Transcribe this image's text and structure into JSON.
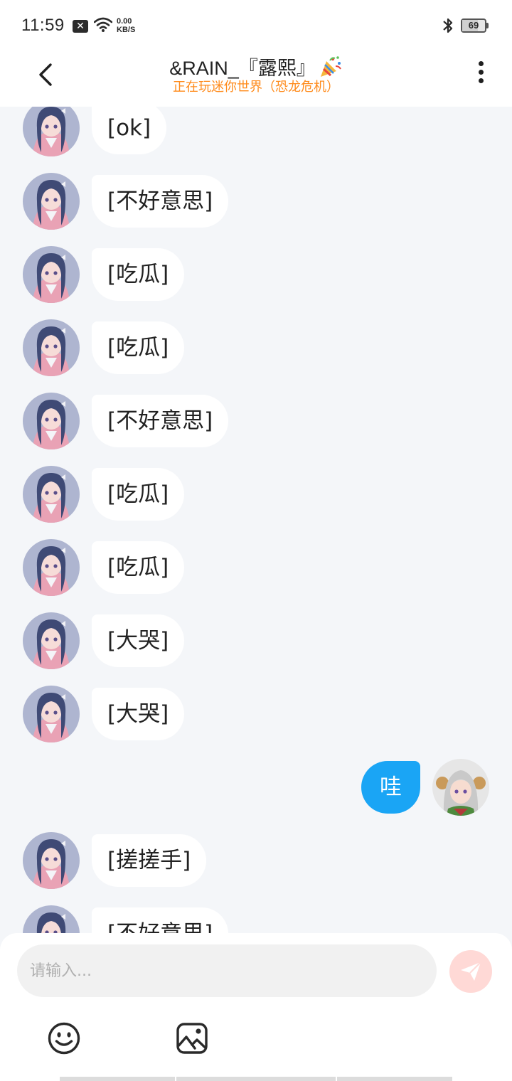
{
  "status_bar": {
    "time": "11:59",
    "speed_value": "0.00",
    "speed_unit": "KB/S",
    "battery": "69",
    "battery_level": 0.69,
    "icons": [
      "notification-x-icon",
      "wifi-icon",
      "bluetooth-icon",
      "battery-icon"
    ]
  },
  "header": {
    "title": "&RAIN_『露熙』",
    "subtitle": "正在玩迷你世界（恐龙危机）",
    "subtitle_color": "#ff8a1a",
    "icons": [
      "back-arrow-icon",
      "party-popper-icon",
      "more-vertical-icon"
    ]
  },
  "messages": [
    {
      "side": "left",
      "text": "[ok]"
    },
    {
      "side": "left",
      "text": "[不好意思]"
    },
    {
      "side": "left",
      "text": "[吃瓜]"
    },
    {
      "side": "left",
      "text": "[吃瓜]"
    },
    {
      "side": "left",
      "text": "[不好意思]"
    },
    {
      "side": "left",
      "text": "[吃瓜]"
    },
    {
      "side": "left",
      "text": "[吃瓜]"
    },
    {
      "side": "left",
      "text": "[大哭]"
    },
    {
      "side": "left",
      "text": "[大哭]"
    },
    {
      "side": "right",
      "text": "哇"
    },
    {
      "side": "left",
      "text": "[搓搓手]"
    },
    {
      "side": "left",
      "text": "[不好意思]"
    }
  ],
  "colors": {
    "background": "#f4f6f9",
    "bubble_left": "#ffffff",
    "bubble_right": "#1aa5f5",
    "send_button": "#ffd9d6"
  },
  "input": {
    "placeholder": "请输入...",
    "value": "",
    "icons": [
      "send-icon",
      "emoji-icon",
      "image-icon"
    ]
  }
}
